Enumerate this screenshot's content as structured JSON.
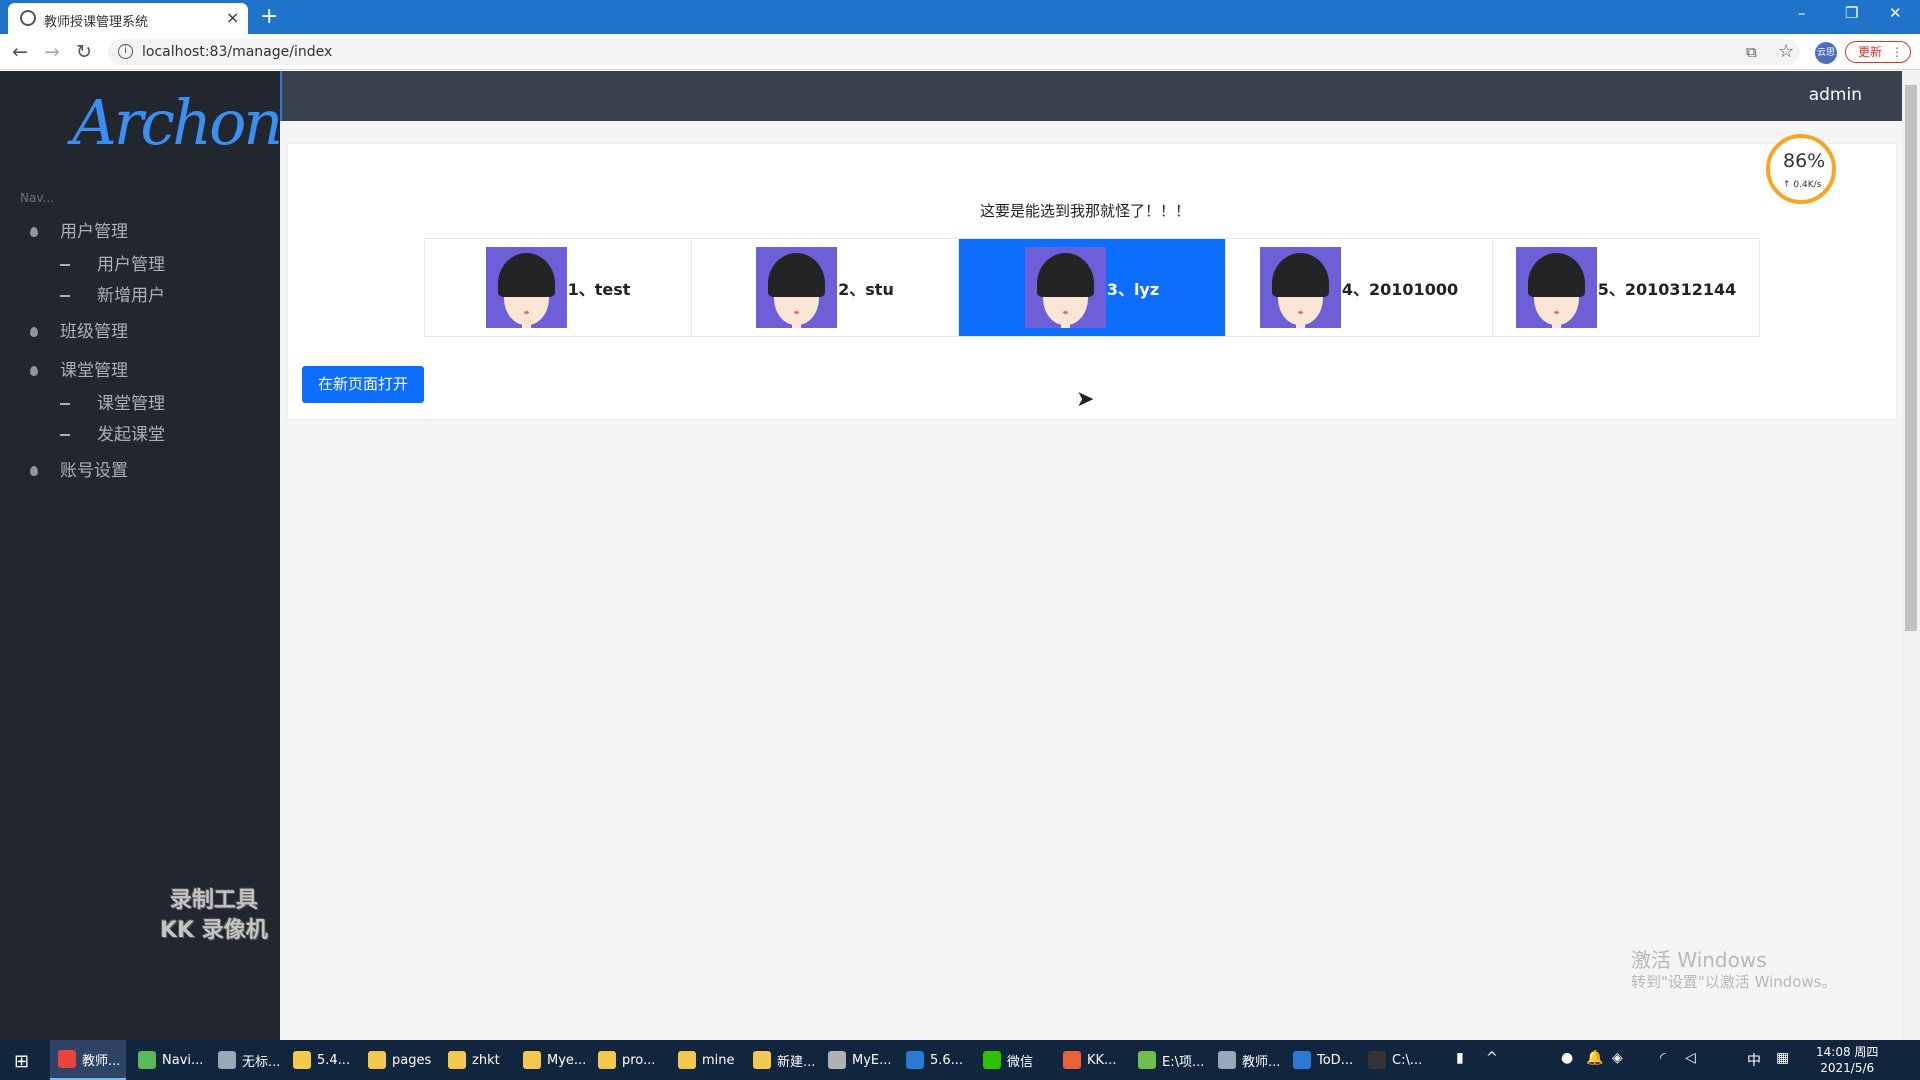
{
  "browser": {
    "tab_title": "教师授课管理系统",
    "tab_close": "×",
    "new_tab": "+",
    "url": "localhost:83/manage/index",
    "update_label": "更新",
    "update_dots": "⋮",
    "ext_label": "云思",
    "window_min": "–",
    "window_restore": "❐",
    "window_close": "✕"
  },
  "sidebar": {
    "logo": "Archon",
    "nav_label": "Nav...",
    "groups": [
      {
        "label": "用户管理",
        "children": [
          "用户管理",
          "新增用户"
        ]
      },
      {
        "label": "班级管理",
        "children": []
      },
      {
        "label": "课堂管理",
        "children": [
          "课堂管理",
          "发起课堂"
        ]
      },
      {
        "label": "账号设置",
        "children": []
      }
    ]
  },
  "watermark": {
    "line1": "录制工具",
    "line2": "KK 录像机"
  },
  "header": {
    "user": "admin"
  },
  "main": {
    "prompt": "这要是能选到我那就怪了！！！",
    "students": [
      {
        "label": "1、test",
        "active": false
      },
      {
        "label": "2、stu",
        "active": false
      },
      {
        "label": "3、lyz",
        "active": true
      },
      {
        "label": "4、20101000",
        "active": false
      },
      {
        "label": "5、2010312144",
        "active": false
      }
    ],
    "open_button": "在新页面打开"
  },
  "speed_widget": {
    "percent": "86%",
    "rate": "↑ 0.4K/s"
  },
  "activate": {
    "line1": "激活 Windows",
    "line2": "转到\"设置\"以激活 Windows。"
  },
  "taskbar": {
    "items": [
      {
        "label": "教师...",
        "color": "#e8453c",
        "active": true
      },
      {
        "label": "Navi...",
        "color": "#5cb85c",
        "active": false
      },
      {
        "label": "无标...",
        "color": "#9aa7b8",
        "active": false
      },
      {
        "label": "5.4...",
        "color": "#f2c94c",
        "active": false
      },
      {
        "label": "pages",
        "color": "#f2c94c",
        "active": false
      },
      {
        "label": "zhkt",
        "color": "#f2c94c",
        "active": false
      },
      {
        "label": "Mye...",
        "color": "#f2c94c",
        "active": false
      },
      {
        "label": "pro...",
        "color": "#f2c94c",
        "active": false
      },
      {
        "label": "mine",
        "color": "#f2c94c",
        "active": false
      },
      {
        "label": "新建...",
        "color": "#f2c94c",
        "active": false
      },
      {
        "label": "MyE...",
        "color": "#b0b0b0",
        "active": false
      },
      {
        "label": "5.6...",
        "color": "#2a7ad3",
        "active": false
      },
      {
        "label": "微信",
        "color": "#2dc100",
        "active": false
      },
      {
        "label": "KK...",
        "color": "#e8623c",
        "active": false
      },
      {
        "label": "E:\\项...",
        "color": "#6fbf4f",
        "active": false
      },
      {
        "label": "教师...",
        "color": "#9aa7b8",
        "active": false
      },
      {
        "label": "ToD...",
        "color": "#2a7ad3",
        "active": false
      },
      {
        "label": "C:\\...",
        "color": "#333333",
        "active": false
      }
    ],
    "ime": "中",
    "time": "14:08 周四",
    "date": "2021/5/6"
  }
}
